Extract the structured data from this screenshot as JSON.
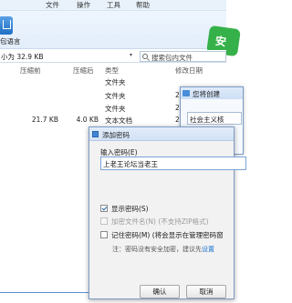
{
  "menu": {
    "file": "文件",
    "edit": "操作",
    "tools": "工具",
    "help": "帮助"
  },
  "toolbar": {
    "language_label": "包语言",
    "badge_char": "安"
  },
  "pathbar": {
    "text": "小为 32.9 KB",
    "dropdown_glyph": "▾",
    "search_placeholder": "搜索包内文件"
  },
  "columns": {
    "compressed": "压缩前",
    "compressed_after": "压缩后",
    "type": "类型",
    "modified": "修改日期"
  },
  "files": [
    {
      "size_before": "",
      "size_after": "",
      "type": "文件夹",
      "date": ""
    },
    {
      "size_before": "",
      "size_after": "",
      "type": "文件夹",
      "date": "2"
    },
    {
      "size_before": "",
      "size_after": "",
      "type": "文件夹",
      "date": "2"
    },
    {
      "size_before": "21.7 KB",
      "size_after": "4.0 KB",
      "type": "文本文档",
      "date": "2"
    }
  ],
  "dialog_behind": {
    "title": "您将创建",
    "field_text": "社会主义核"
  },
  "dialog": {
    "title": "添加密码",
    "password_label": "输入密码(E)",
    "password_value": "上老王论坛当老王",
    "show_password": "显示密码(S)",
    "encrypt_names": "加密文件名(N) (不支持ZIP格式)",
    "remember_password": "记住密码(M) (将会显示在管理密码窗",
    "note_prefix": "注：密码没有安全加密，建议先",
    "note_link": "设置",
    "ok": "确认",
    "cancel": "取消"
  }
}
